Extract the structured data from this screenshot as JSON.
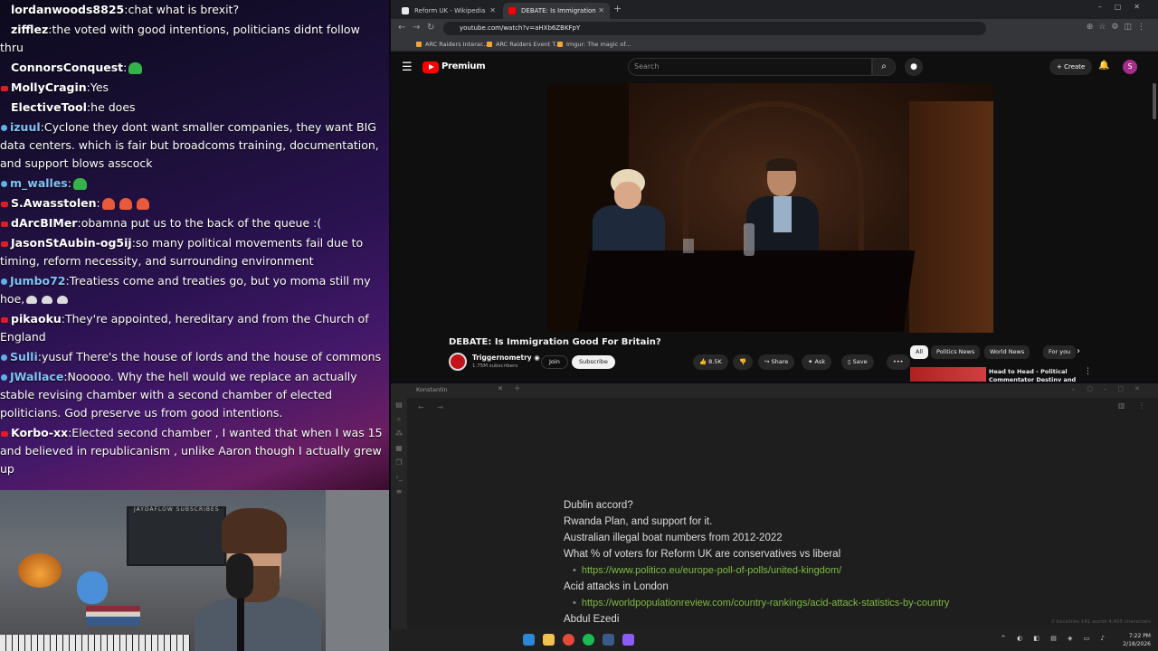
{
  "chat": {
    "messages": [
      {
        "user": "lordanwoods8825",
        "text": "chat what is brexit?",
        "badge": "none"
      },
      {
        "user": "zifflez",
        "text": "the voted with good intentions, politicians didnt follow thru",
        "badge": "none"
      },
      {
        "user": "ConnorsConquest",
        "text": "",
        "badge": "none",
        "emote": "frog-emote"
      },
      {
        "user": "MollyCragin",
        "text": "Yes",
        "badge": "red"
      },
      {
        "user": "ElectiveTool",
        "text": "he does",
        "badge": "none"
      },
      {
        "user": "izuul",
        "text": "Cyclone they dont want smaller companies, they want BIG data centers. which is fair but broadcoms training, documentation, and support blows asscock",
        "badge": "blue",
        "blue": true
      },
      {
        "user": "m_walles",
        "text": "",
        "badge": "blue",
        "blue": true,
        "emote": "frog-emote"
      },
      {
        "user": "S.Awasstolen",
        "text": "",
        "badge": "red",
        "emote": "red-emotes"
      },
      {
        "user": "dArcBIMer",
        "text": "obamna put us to the back of the queue :(",
        "badge": "red"
      },
      {
        "user": "JasonStAubin-og5ij",
        "text": "so many political movements fail due to timing, reform necessity, and surrounding environment",
        "badge": "red"
      },
      {
        "user": "Jumbo72",
        "text": "Treatiess come and treaties go, but yo moma still my hoe,",
        "badge": "blue",
        "blue": true,
        "emote": "goose-emotes"
      },
      {
        "user": "pikaoku",
        "text": "They're appointed, hereditary and from the Church of England",
        "badge": "red"
      },
      {
        "user": "Sulli",
        "text": "yusuf There's the house of lords and the house of commons",
        "badge": "blue",
        "blue": true
      },
      {
        "user": "JWallace",
        "text": "Nooooo. Why the hell would we replace an actually stable revising chamber with a second chamber of elected politicians. God preserve us from good intentions.",
        "badge": "blue",
        "blue": true
      },
      {
        "user": "Korbo-xx",
        "text": "Elected second chamber , I wanted that when I was 15 and believed in republicanism , unlike Aaron though I actually grew up",
        "badge": "red"
      }
    ]
  },
  "webcam": {
    "panel_label": "JAYDAFLOW SUBSCRIBES"
  },
  "browser": {
    "tabs": [
      {
        "label": "Reform UK - Wikipedia",
        "active": false,
        "fav_color": "#e8eaed"
      },
      {
        "label": "DEBATE: Is Immigration Go...",
        "active": true,
        "fav_color": "#ff0000"
      }
    ],
    "url": "youtube.com/watch?v=aHXb6ZBKFpY",
    "bookmarks": [
      "ARC Raiders Interac...",
      "ARC Raiders Event T...",
      "Imgur: The magic of..."
    ]
  },
  "youtube": {
    "brand": "Premium",
    "search_placeholder": "Search",
    "create_label": "Create",
    "avatar_letter": "S",
    "video_title": "DEBATE: Is Immigration Good For Britain?",
    "channel_name": "Triggernometry",
    "channel_subs": "1.75M subscribers",
    "join_label": "Join",
    "subscribe_label": "Subscribe",
    "like_count": "8.5K",
    "share_label": "Share",
    "ask_label": "Ask",
    "save_label": "Save",
    "chips": [
      "All",
      "Politics News",
      "World News",
      "For you"
    ],
    "rec_title": "Head to Head - Political Commentator Destiny and"
  },
  "notes": {
    "tab_label": "Konstantin",
    "lines": [
      {
        "text": "Dublin accord?",
        "link": false
      },
      {
        "text": "Rwanda Plan, and support for it.",
        "link": false
      },
      {
        "text": "Australian illegal boat numbers from 2012-2022",
        "link": false
      },
      {
        "text": "What % of voters for Reform UK are conservatives vs liberal",
        "link": false
      },
      {
        "text": "https://www.politico.eu/europe-poll-of-polls/united-kingdom/",
        "link": true
      },
      {
        "text": "Acid attacks in London",
        "link": false
      },
      {
        "text": "https://worldpopulationreview.com/country-rankings/acid-attack-statistics-by-country",
        "link": true
      },
      {
        "text": "Abdul Ezedi",
        "link": false
      }
    ],
    "status": "0 backlinks    141 words  4,405 characters"
  },
  "taskbar": {
    "time": "7:22 PM",
    "date": "2/18/2026"
  }
}
